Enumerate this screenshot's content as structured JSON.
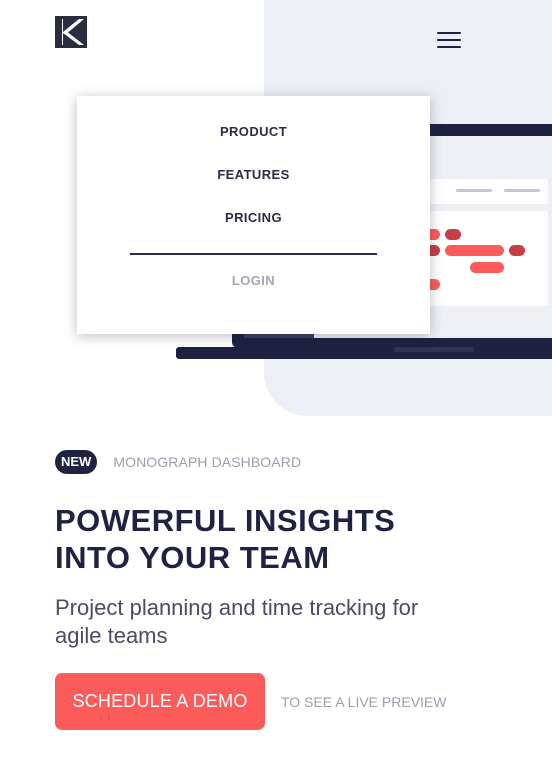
{
  "header": {
    "logo_icon": "brand-k-logo-icon",
    "menu_icon": "hamburger-menu-icon"
  },
  "dropdown": {
    "items": [
      "PRODUCT",
      "FEATURES",
      "PRICING"
    ],
    "login_label": "LOGIN"
  },
  "hero": {
    "badge": "NEW",
    "tag": "MONOGRAPH DASHBOARD",
    "headline_lines": [
      "POWERFUL INSIGHTS",
      "INTO YOUR TEAM"
    ],
    "subtitle_lines": [
      "Project planning and time tracking for",
      "agile teams"
    ],
    "cta_label": "SCHEDULE A DEMO",
    "cta_note": "TO SEE A LIVE PREVIEW"
  },
  "colors": {
    "accent": "#fb5c5a",
    "navy": "#1f2341",
    "hero_bg": "#eceff5",
    "muted": "#9b9eab"
  }
}
